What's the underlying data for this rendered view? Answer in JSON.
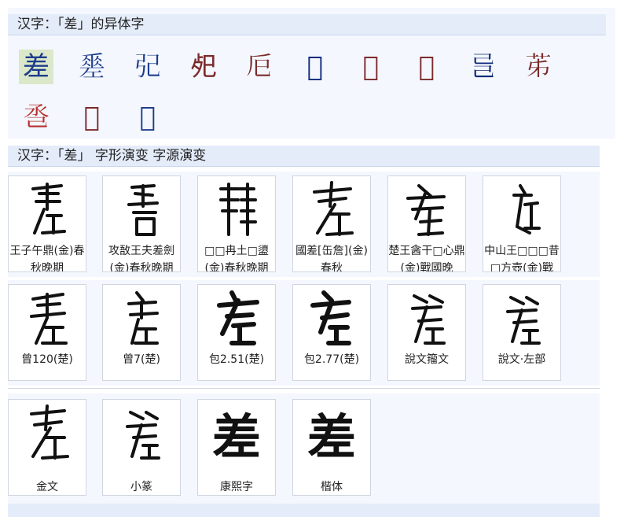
{
  "variants": {
    "header": "汉字：「差」的异体字",
    "glyphs": [
      "差",
      "𢀩",
      "𢀶",
      "𢀸",
      "𢀴",
      "𢀳",
      "𡯮",
      "𢀭",
      "𢀵",
      "𦬷",
      "𢀷",
      "𢀲",
      "𢀤"
    ],
    "selected_index": 0,
    "colors": [
      "#1d3d8c",
      "#1d3d8c",
      "#1d3d8c",
      "#7a2a2a",
      "#7a2a2a",
      "#0d2a7a",
      "#7a2a2a",
      "#7a2a2a",
      "#0d2a7a",
      "#7a2a2a",
      "#b53030",
      "#7a2a2a",
      "#1d3d8c"
    ]
  },
  "evolution": {
    "header": "汉字：「差」 字形演变 字源演变",
    "row1": [
      "王子午鼎(金)春秋晚期",
      "攻敔王夫差劍(金)春秋晚期",
      "□□冉土□盨(金)春秋晚期",
      "國差[缶詹](金)春秋",
      "楚王酓干□心鼎(金)戰國晚",
      "中山王□□□昔□方壺(金)戰"
    ],
    "row2": [
      "曾120(楚)",
      "曾7(楚)",
      "包2.51(楚)",
      "包2.77(楚)",
      "說文籀文",
      "說文·左部"
    ],
    "row3": [
      "金文",
      "小篆",
      "康熙字",
      "楷体"
    ],
    "row3_glyphs": [
      "差",
      "差"
    ]
  }
}
